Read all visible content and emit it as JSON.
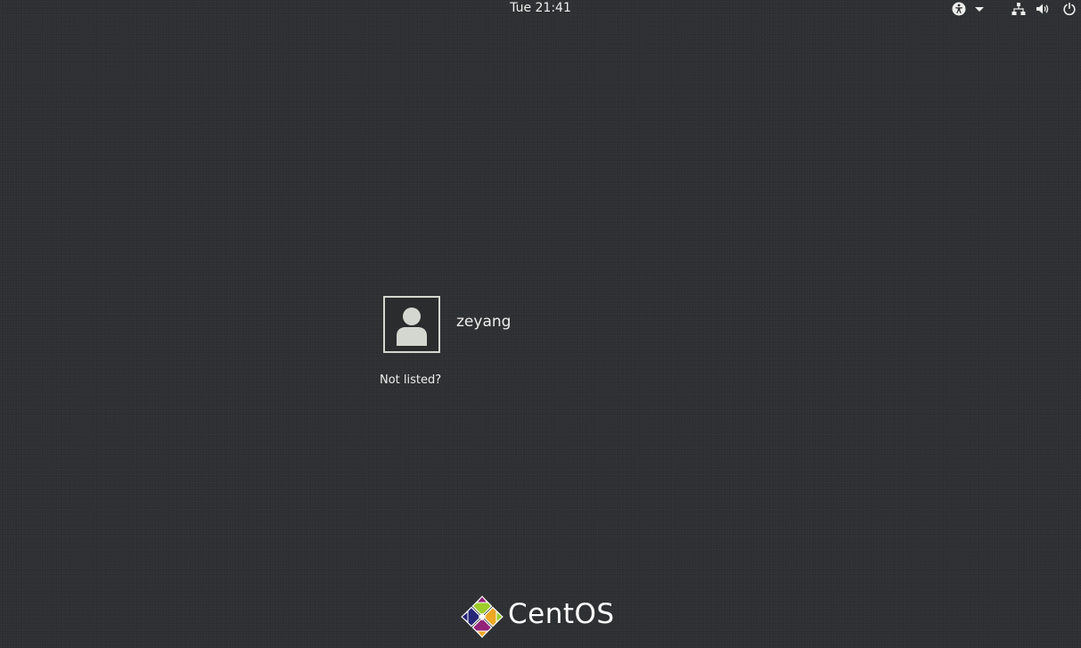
{
  "top_bar": {
    "clock": "Tue 21:41",
    "icons": {
      "accessibility": "accessibility-icon",
      "accessibility_menu": "chevron-down-icon",
      "network": "network-wired-icon",
      "volume": "volume-icon",
      "power": "power-icon"
    }
  },
  "users": [
    {
      "name": "zeyang",
      "avatar": "user-silhouette-icon"
    }
  ],
  "not_listed_label": "Not listed?",
  "branding": {
    "logo_text": "CentOS",
    "logo_icon": "centos-logo-icon",
    "colors": {
      "yellow": "#efa724",
      "green": "#9ccd2a",
      "purple": "#932279",
      "blue": "#262577"
    }
  },
  "colors": {
    "background": "#2d3032",
    "text": "#eeeeec",
    "avatar_border": "#d3d7cf"
  }
}
